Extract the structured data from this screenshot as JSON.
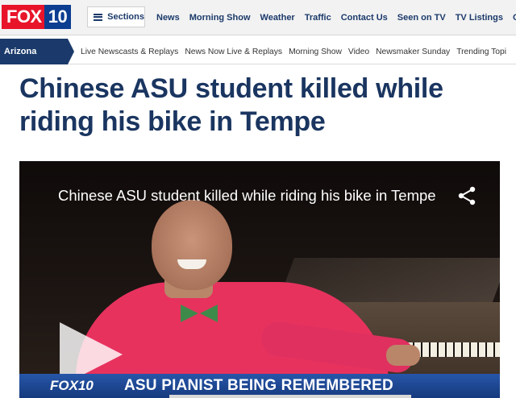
{
  "brand": {
    "logo_word": "FOX",
    "logo_number": "10"
  },
  "topnav": {
    "sections_label": "Sections",
    "links": [
      "News",
      "Morning Show",
      "Weather",
      "Traffic",
      "Contact Us",
      "Seen on TV",
      "TV Listings",
      "C"
    ]
  },
  "subnav": {
    "title": "Arizona News",
    "links": [
      "Live Newscasts & Replays",
      "News Now Live & Replays",
      "Morning Show",
      "Video",
      "Newsmaker Sunday",
      "Trending Topi"
    ]
  },
  "article": {
    "headline": "Chinese ASU student killed while riding his bike in Tempe"
  },
  "video": {
    "title": "Chinese ASU student killed while riding his bike in Tempe",
    "lower_third_logo": "FOX10",
    "lower_third_text": "ASU PIANIST BEING REMEMBERED"
  },
  "colors": {
    "accent_navy": "#1b3a6b",
    "brand_red": "#e8142a",
    "headline": "#1a3560"
  }
}
